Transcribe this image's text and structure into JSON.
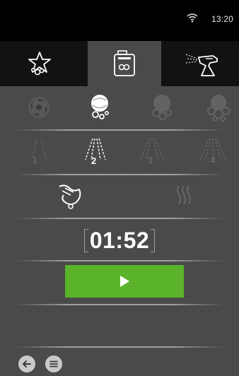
{
  "status_bar": {
    "time": "13:20",
    "wifi_icon": "wifi-icon"
  },
  "tabs": [
    {
      "icon": "star-bubbles-icon",
      "active": false
    },
    {
      "icon": "detergent-canister-icon",
      "active": true
    },
    {
      "icon": "spray-bottle-icon",
      "active": false
    }
  ],
  "spin_modes": [
    {
      "icon": "swirl-icon",
      "selected": false
    },
    {
      "icon": "ball-bubbles-icon",
      "selected": true
    },
    {
      "icon": "ball-bubbles-medium-icon",
      "selected": false
    },
    {
      "icon": "ball-bubbles-large-icon",
      "selected": false
    }
  ],
  "spray_levels": [
    {
      "label": "1",
      "selected": false
    },
    {
      "label": "2",
      "selected": true
    },
    {
      "label": "3",
      "selected": false
    },
    {
      "label": "4",
      "selected": false
    }
  ],
  "air_options": [
    {
      "icon": "blow-air-icon",
      "selected": true
    },
    {
      "icon": "heat-waves-icon",
      "selected": false
    }
  ],
  "timer": {
    "value": "01:52"
  },
  "play_button": {
    "icon": "play-icon"
  },
  "bottom_bar": {
    "back_icon": "back-arrow-icon",
    "menu_icon": "menu-icon"
  },
  "colors": {
    "accent_green": "#5ab32a",
    "panel": "#4a4a4a",
    "header": "#000000"
  }
}
